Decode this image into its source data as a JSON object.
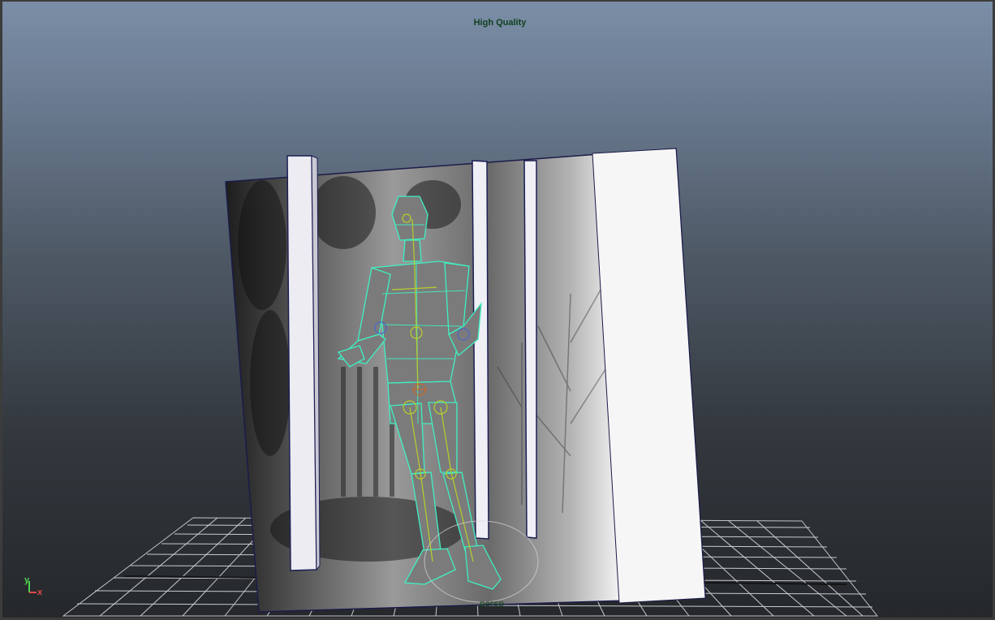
{
  "viewport": {
    "title": "High Quality",
    "camera_label": "persp",
    "axis": {
      "y_label": "y",
      "x_label": "x"
    },
    "colors": {
      "sky_top": "#7b8ea7",
      "sky_bottom": "#25282b",
      "title_text": "#0f3f1c",
      "wireframe": "#3ff0c2",
      "joint": "#b8cf2b",
      "grid": "#d9dde2"
    }
  },
  "scene": {
    "objects": [
      "image-plane-backdrop",
      "pillar-left",
      "pillar-middle",
      "pillar-right",
      "character-mesh",
      "ground-grid"
    ]
  }
}
